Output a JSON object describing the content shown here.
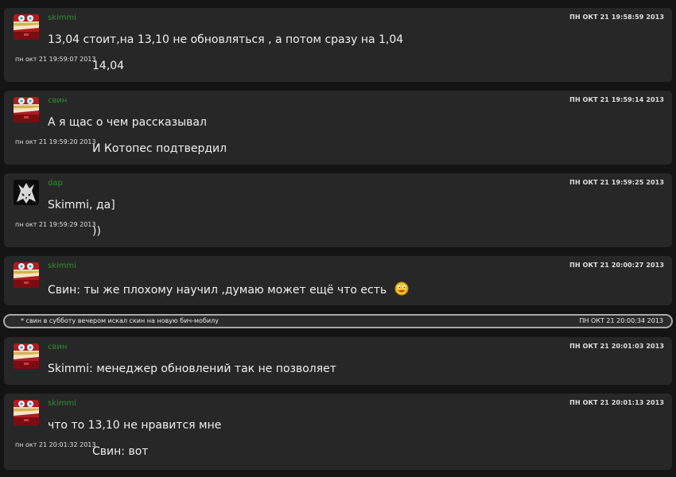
{
  "messages": [
    {
      "author": "skimmi",
      "avatar_icon": "red-game-avatar-icon",
      "time": "ПН ОКТ 21 19:58:59 2013",
      "text": "13,04 стоит,на 13,10 не обновляться , а потом сразу на 1,04",
      "followup_time": "пн окт 21 19:59:07 2013",
      "followup_text": "14,04"
    },
    {
      "author": "свин",
      "avatar_icon": "red-game-avatar-icon",
      "time": "ПН ОКТ 21 19:59:14 2013",
      "text": "А я щас о чем рассказывал",
      "followup_time": "пн окт 21 19:59:20 2013",
      "followup_text": "И Котопес подтвердил"
    },
    {
      "author": "dap",
      "avatar_icon": "wolf-sigil-avatar-icon",
      "time": "ПН ОКТ 21 19:59:25 2013",
      "text": "Skimmi, да]",
      "followup_time": "пн окт 21 19:59:29 2013",
      "followup_text": "))"
    },
    {
      "author": "skimmi",
      "avatar_icon": "red-game-avatar-icon",
      "time": "ПН ОКТ 21 20:00:27 2013",
      "text": "Свин:  ты же плохому научил ,думаю может ещё что есть",
      "emoji": "smiley-face-icon"
    },
    {
      "author": "свин",
      "avatar_icon": "red-game-avatar-icon",
      "time": "ПН ОКТ 21 20:01:03 2013",
      "text": "Skimmi: менеджер обновлений так не позволяет"
    },
    {
      "author": "skimmi",
      "avatar_icon": "red-game-avatar-icon",
      "time": "ПН ОКТ 21 20:01:13 2013",
      "text": "что то 13,10 не нравится мне",
      "followup_time": "пн окт 21 20:01:32 2013",
      "followup_text": "Свин: вот"
    }
  ],
  "system_message": {
    "text": "* свин в субботу вечером искал скин на новую бич-мобилу",
    "time": "ПН ОКТ 21 20:00:34 2013"
  },
  "colors": {
    "background": "#141414",
    "bubble": "#272727",
    "author": "#2f8f2f",
    "system_border": "#a9a9a9"
  }
}
